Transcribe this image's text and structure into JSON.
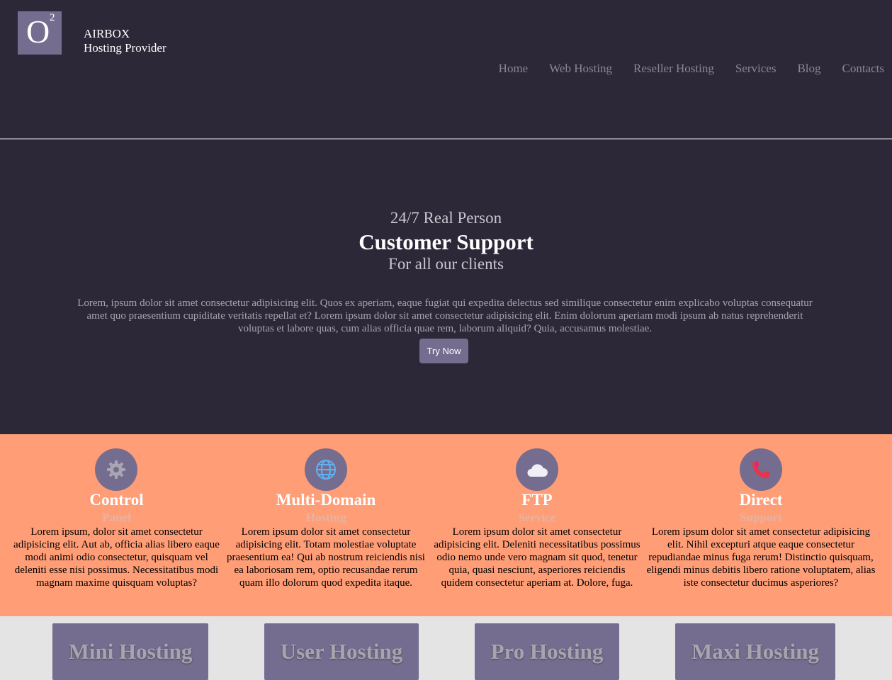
{
  "logo": {
    "letter": "O",
    "superscript": "2"
  },
  "brand": {
    "name": "AIRBOX",
    "tagline": "Hosting Provider"
  },
  "nav": {
    "items": [
      {
        "label": "Home"
      },
      {
        "label": "Web Hosting"
      },
      {
        "label": "Reseller Hosting"
      },
      {
        "label": "Services"
      },
      {
        "label": "Blog"
      },
      {
        "label": "Contacts"
      }
    ]
  },
  "hero": {
    "pretitle": "24/7 Real Person",
    "title": "Customer Support",
    "subtitle": "For all our clients",
    "body": "Lorem, ipsum dolor sit amet consectetur adipisicing elit. Quos ex aperiam, eaque fugiat qui expedita delectus sed similique consectetur enim explicabo voluptas consequatur amet quo praesentium cupiditate veritatis repellat et? Lorem ipsum dolor sit amet consectetur adipisicing elit. Enim dolorum aperiam modi ipsum ab natus reprehenderit voluptas et labore quas, cum alias officia quae rem, laborum aliquid? Quia, accusamus molestiae.",
    "button": "Try Now"
  },
  "features": [
    {
      "icon": "gear-icon",
      "title": "Control",
      "subtitle": "Panel",
      "body": "Lorem ipsum, dolor sit amet consectetur adipisicing elit. Aut ab, officia alias libero eaque modi animi odio consectetur, quisquam vel deleniti esse nisi possimus. Necessitatibus modi magnam maxime quisquam voluptas?"
    },
    {
      "icon": "globe-icon",
      "title": "Multi-Domain",
      "subtitle": "Hosting",
      "body": "Lorem ipsum dolor sit amet consectetur adipisicing elit. Totam molestiae voluptate praesentium ea! Qui ab nostrum reiciendis nisi ea laboriosam rem, optio recusandae rerum quam illo dolorum quod expedita itaque."
    },
    {
      "icon": "cloud-icon",
      "title": "FTP",
      "subtitle": "Service",
      "body": "Lorem ipsum dolor sit amet consectetur adipisicing elit. Deleniti necessitatibus possimus odio nemo unde vero magnam sit quod, tenetur quia, quasi nesciunt, asperiores reiciendis quidem consectetur aperiam at. Dolore, fuga."
    },
    {
      "icon": "phone-icon",
      "title": "Direct",
      "subtitle": "Support",
      "body": "Lorem ipsum dolor sit amet consectetur adipisicing elit. Nihil excepturi atque eaque consectetur repudiandae minus fuga rerum! Distinctio quisquam, eligendi minus debitis libero ratione voluptatem, alias iste consectetur ducimus asperiores?"
    }
  ],
  "plans": [
    {
      "title": "Mini Hosting"
    },
    {
      "title": "User Hosting"
    },
    {
      "title": "Pro Hosting"
    },
    {
      "title": "Maxi Hosting"
    }
  ],
  "colors": {
    "background": "#2c2838",
    "accent": "#756d8f",
    "features_bg": "#ff9d77",
    "plans_bg": "#e4e4e4"
  }
}
